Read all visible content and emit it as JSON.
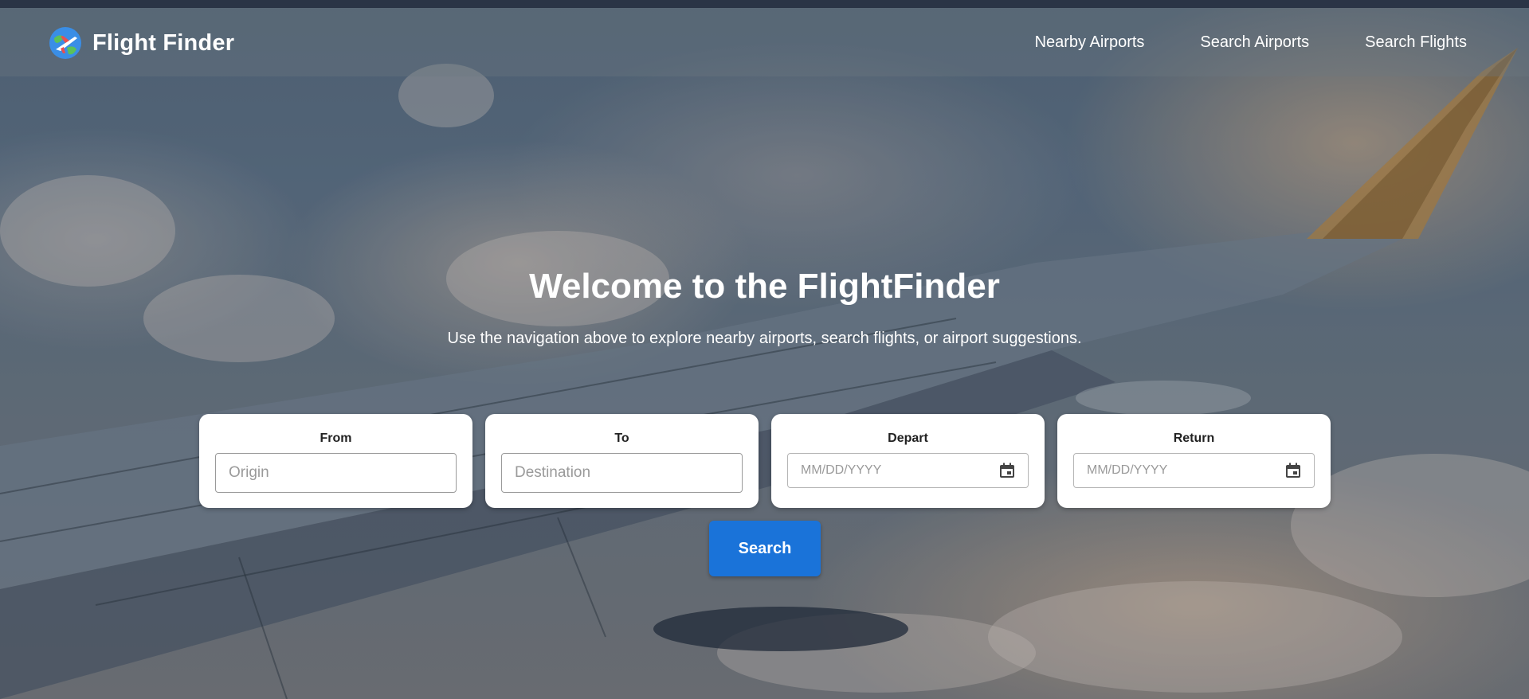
{
  "app": {
    "title": "Flight Finder",
    "logo_icon": "globe-airplane-icon"
  },
  "nav": {
    "items": [
      {
        "label": "Nearby Airports"
      },
      {
        "label": "Search Airports"
      },
      {
        "label": "Search Flights"
      }
    ]
  },
  "hero": {
    "title": "Welcome to the FlightFinder",
    "subtitle": "Use the navigation above to explore nearby airports, search flights, or airport suggestions."
  },
  "search_form": {
    "from": {
      "label": "From",
      "placeholder": "Origin",
      "value": ""
    },
    "to": {
      "label": "To",
      "placeholder": "Destination",
      "value": ""
    },
    "depart": {
      "label": "Depart",
      "placeholder": "MM/DD/YYYY",
      "icon": "calendar-icon"
    },
    "return": {
      "label": "Return",
      "placeholder": "MM/DD/YYYY",
      "icon": "calendar-icon"
    },
    "submit_label": "Search"
  },
  "colors": {
    "accent": "#1a73d9",
    "topstrip": "#2f3a4c",
    "card_bg": "#ffffff"
  }
}
